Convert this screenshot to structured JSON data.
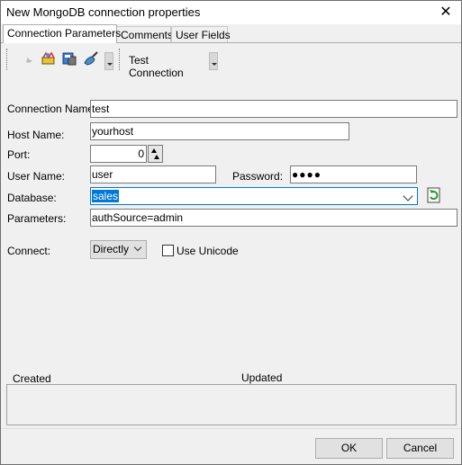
{
  "window": {
    "title": "New MongoDB connection properties",
    "close_glyph": "✕"
  },
  "tabs": [
    {
      "label": "Connection Parameters"
    },
    {
      "label": "Comments"
    },
    {
      "label": "User Fields"
    }
  ],
  "toolbar": {
    "icons": [
      "moon-icon",
      "wizard-icon",
      "database-icon",
      "brush-icon"
    ],
    "test_connection_label": "Test Connection"
  },
  "form": {
    "connection_name": {
      "label": "Connection Name:",
      "value": "test"
    },
    "host_name": {
      "label": "Host Name:",
      "value": "yourhost"
    },
    "port": {
      "label": "Port:",
      "value": "0"
    },
    "user_name": {
      "label": "User Name:",
      "value": "user"
    },
    "password": {
      "label": "Password:",
      "value": "●●●●"
    },
    "database": {
      "label": "Database:",
      "value": "sales"
    },
    "parameters": {
      "label": "Parameters:",
      "value": "authSource=admin"
    },
    "connect": {
      "label": "Connect:",
      "value": "Directly"
    },
    "use_unicode": {
      "label": "Use Unicode",
      "checked": false
    }
  },
  "info": {
    "created_label": "Created",
    "updated_label": "Updated"
  },
  "buttons": {
    "ok": "OK",
    "cancel": "Cancel"
  },
  "colors": {
    "accent": "#0078d7",
    "window_bg": "#f0f0f0"
  }
}
